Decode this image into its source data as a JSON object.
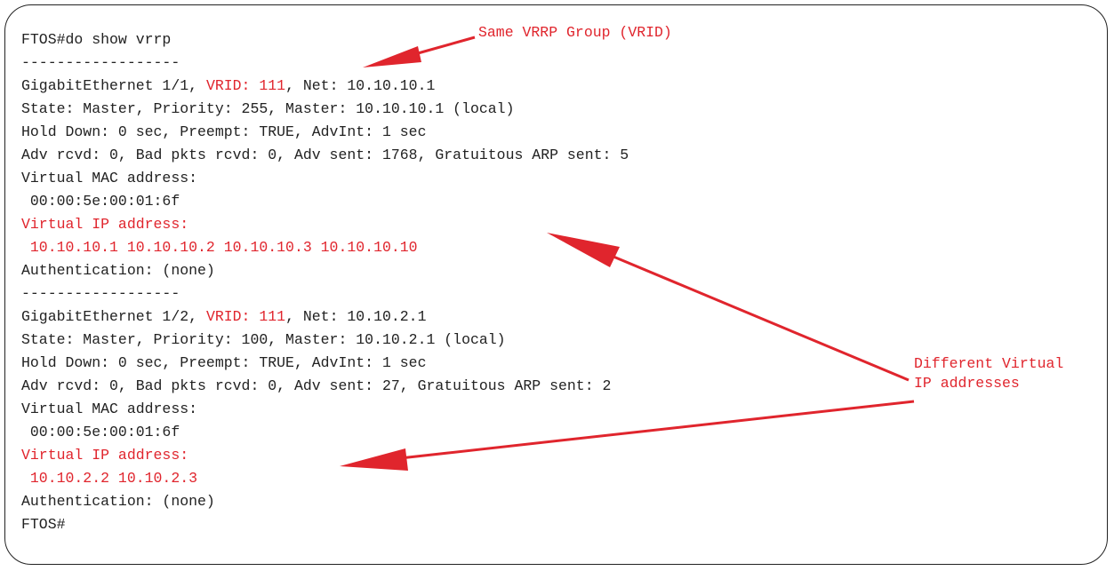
{
  "terminal": {
    "lines": [
      {
        "parts": [
          {
            "text": "FTOS#do show vrrp",
            "hl": false
          }
        ]
      },
      {
        "parts": [
          {
            "text": "------------------",
            "hl": false
          }
        ]
      },
      {
        "parts": [
          {
            "text": "GigabitEthernet 1/1, ",
            "hl": false
          },
          {
            "text": "VRID: 111",
            "hl": true
          },
          {
            "text": ", Net: 10.10.10.1",
            "hl": false
          }
        ]
      },
      {
        "parts": [
          {
            "text": "State: Master, Priority: 255, Master: 10.10.10.1 (local)",
            "hl": false
          }
        ]
      },
      {
        "parts": [
          {
            "text": "Hold Down: 0 sec, Preempt: TRUE, AdvInt: 1 sec",
            "hl": false
          }
        ]
      },
      {
        "parts": [
          {
            "text": "Adv rcvd: 0, Bad pkts rcvd: 0, Adv sent: 1768, Gratuitous ARP sent: 5",
            "hl": false
          }
        ]
      },
      {
        "parts": [
          {
            "text": "Virtual MAC address:",
            "hl": false
          }
        ]
      },
      {
        "parts": [
          {
            "text": " 00:00:5e:00:01:6f",
            "hl": false
          }
        ]
      },
      {
        "parts": [
          {
            "text": "Virtual IP address:",
            "hl": true
          }
        ]
      },
      {
        "parts": [
          {
            "text": " 10.10.10.1 10.10.10.2 10.10.10.3 10.10.10.10",
            "hl": true
          }
        ]
      },
      {
        "parts": [
          {
            "text": "Authentication: (none)",
            "hl": false
          }
        ]
      },
      {
        "parts": [
          {
            "text": "------------------",
            "hl": false
          }
        ]
      },
      {
        "parts": [
          {
            "text": "GigabitEthernet 1/2, ",
            "hl": false
          },
          {
            "text": "VRID: 111",
            "hl": true
          },
          {
            "text": ", Net: 10.10.2.1",
            "hl": false
          }
        ]
      },
      {
        "parts": [
          {
            "text": "State: Master, Priority: 100, Master: 10.10.2.1 (local)",
            "hl": false
          }
        ]
      },
      {
        "parts": [
          {
            "text": "Hold Down: 0 sec, Preempt: TRUE, AdvInt: 1 sec",
            "hl": false
          }
        ]
      },
      {
        "parts": [
          {
            "text": "Adv rcvd: 0, Bad pkts rcvd: 0, Adv sent: 27, Gratuitous ARP sent: 2",
            "hl": false
          }
        ]
      },
      {
        "parts": [
          {
            "text": "Virtual MAC address:",
            "hl": false
          }
        ]
      },
      {
        "parts": [
          {
            "text": " 00:00:5e:00:01:6f",
            "hl": false
          }
        ]
      },
      {
        "parts": [
          {
            "text": "Virtual IP address:",
            "hl": true
          }
        ]
      },
      {
        "parts": [
          {
            "text": " 10.10.2.2 10.10.2.3",
            "hl": true
          }
        ]
      },
      {
        "parts": [
          {
            "text": "Authentication: (none)",
            "hl": false
          }
        ]
      },
      {
        "parts": [
          {
            "text": "FTOS#",
            "hl": false
          }
        ]
      }
    ]
  },
  "annotations": {
    "same_vrid": "Same VRRP Group (VRID)",
    "different_vip": "Different Virtual\nIP addresses"
  },
  "colors": {
    "highlight": "#e0252d",
    "text": "#222222",
    "frame": "#222222"
  }
}
